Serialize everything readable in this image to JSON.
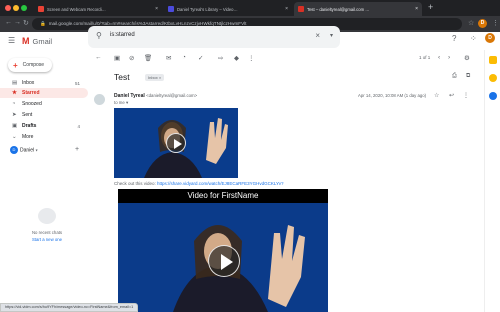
{
  "browser": {
    "tabs": [
      {
        "title": "Screen and Webcam Recordi…",
        "active": false,
        "favicon_color": "#e94235"
      },
      {
        "title": "Daniel Tyreal's Library – Video…",
        "active": false,
        "favicon_color": "#4b4bdc"
      },
      {
        "title": "Test – danieltyreal@gmail.com …",
        "active": true,
        "favicon_color": "#d93025"
      }
    ],
    "new_tab": "+",
    "url": "mail.google.com/mail/u/0/?tab=rm#search/is%3Astarred/KtbxLvHLnzvCzjvHWkfqTNtjlczHwmFVlt",
    "profile_initial": "D"
  },
  "gmail": {
    "app_name": "Gmail",
    "search_value": "is:starred",
    "compose_label": "Compose",
    "nav": [
      {
        "label": "Inbox",
        "icon": "inbox-icon",
        "glyph": "▤",
        "count": "51",
        "selected": false
      },
      {
        "label": "Starred",
        "icon": "star-icon",
        "glyph": "★",
        "count": "",
        "selected": true
      },
      {
        "label": "Snoozed",
        "icon": "clock-icon",
        "glyph": "◔",
        "count": "",
        "selected": false
      },
      {
        "label": "Sent",
        "icon": "send-icon",
        "glyph": "➤",
        "count": "",
        "selected": false
      },
      {
        "label": "Drafts",
        "icon": "draft-icon",
        "glyph": "▣",
        "count": "4",
        "selected": false
      },
      {
        "label": "More",
        "icon": "chevron-down-icon",
        "glyph": "⌄",
        "count": "",
        "selected": false
      }
    ],
    "hangouts_user": "Daniel",
    "no_chats": "No recent chats",
    "start_chat": "Start a new one",
    "pager": "1 of 1",
    "email": {
      "subject": "Test",
      "label": "Inbox ×",
      "sender_name": "Daniel Tyreal",
      "sender_email": "<danieltyreal@gmail.com>",
      "to": "to me ▾",
      "date": "Apr 14, 2020, 10:08 AM (1 day ago)",
      "body_text": "Check out this video: ",
      "body_link": "https://share.vidyard.com/watch/EJ8ECaRFE3YGHvdGCKLYv?",
      "video_title": "Video for FirstName"
    },
    "status_url": "https://vid-vidm.com/s/hu9YFh/message/video-nc=FirstName&from_email=1"
  }
}
